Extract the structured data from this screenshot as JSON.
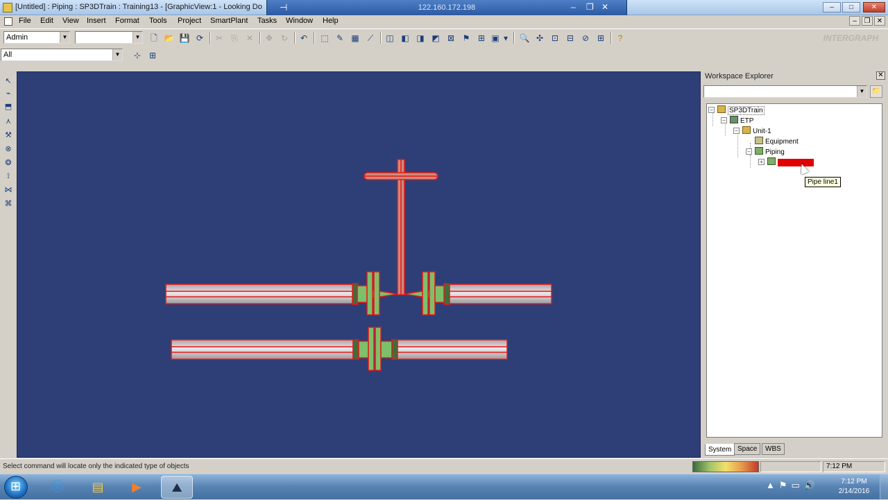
{
  "window": {
    "title": "[Untitled] : Piping : SP3DTrain : Training13 - [GraphicView:1 - Looking Do",
    "remote_ip": "122.160.172.198"
  },
  "menu": [
    "File",
    "Edit",
    "View",
    "Insert",
    "Format",
    "Tools",
    "Project",
    "SmartPlant",
    "Tasks",
    "Window",
    "Help"
  ],
  "toolbar": {
    "permission_group": "Admin",
    "second_combo": "",
    "logo_text": "INTERGRAPH",
    "filter_value": "All"
  },
  "explorer": {
    "title": "Workspace Explorer",
    "filter_combo": "",
    "tree": {
      "root": "SP3DTrain",
      "etp": "ETP",
      "unit": "Unit-1",
      "equipment": "Equipment",
      "piping": "Piping",
      "pipeline": "Pipe line1"
    },
    "tooltip": "Pipe line1",
    "tabs": [
      "System",
      "Space",
      "WBS"
    ],
    "active_tab": "System"
  },
  "status": {
    "message": "Select command will locate only the indicated type of objects",
    "time": "7:12 PM"
  },
  "taskbar": {
    "clock_time": "7:12 PM",
    "clock_date": "2/14/2016"
  },
  "colors": {
    "graphic_background": "#2e3f77",
    "pipe_fill": "#c9c3c6",
    "pipe_highlight": "#e3181b",
    "fitting_fill": "#7fbf6a",
    "selection": "#e00000"
  }
}
